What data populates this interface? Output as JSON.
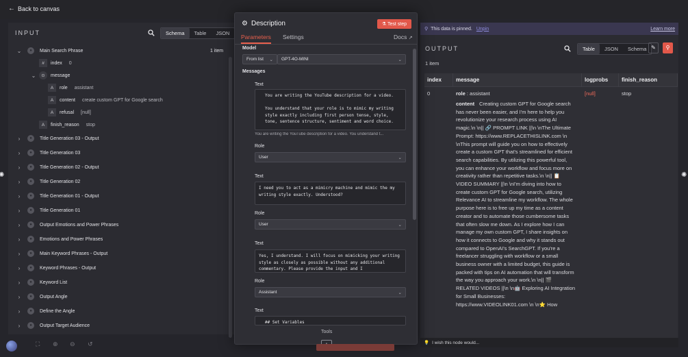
{
  "nav": {
    "back_label": "Back to canvas"
  },
  "input": {
    "header": "INPUT",
    "view_tabs": [
      "Schema",
      "Table",
      "JSON"
    ],
    "active_view": "Schema",
    "root": {
      "name": "Main Search Phrase",
      "count": "1 item"
    },
    "fields": [
      {
        "type": "#",
        "key": "index",
        "value": "0"
      },
      {
        "type": "obj",
        "key": "message",
        "value": ""
      },
      {
        "type": "A",
        "key": "role",
        "value": "assistant"
      },
      {
        "type": "A",
        "key": "content",
        "value": "create custom GPT for Google search"
      },
      {
        "type": "A",
        "key": "refusal",
        "value": "[null]"
      },
      {
        "type": "A",
        "key": "finish_reason",
        "value": "stop"
      }
    ],
    "nodes": [
      "Title Generation 03 - Output",
      "Title Generation 03",
      "Title Generation 02 - Output",
      "Title Generation 02",
      "Title Generation 01 - Output",
      "Title Generation 01",
      "Output Emotions and Power Phrases",
      "Emotions and Power Phrases",
      "Main Keyword Phrases - Output",
      "Keyword Phrases - Output",
      "Keyword List",
      "Output Angle",
      "Define the Angle",
      "Output Target Audience"
    ]
  },
  "modal": {
    "title": "Description",
    "test_button": "Test step",
    "tabs": [
      "Parameters",
      "Settings"
    ],
    "active_tab": "Parameters",
    "docs_label": "Docs",
    "model_label": "Model",
    "model_source": "From list",
    "model_value": "GPT-4O-MINI",
    "messages_label": "Messages",
    "text_label": "Text",
    "role_label": "Role",
    "messages": [
      {
        "text": "You are writing the YouTube description for a video.\n\nYou understand that your role is to mimic my writing style exactly including first person tense, style, tone, sentence structure, sentiment and word choice.",
        "preview": "You are writing the YouTube description for a video. You understand t...",
        "role": "User"
      },
      {
        "text": "I need you to act as a mimicry machine and mimic the my writing style exactly. Understood?",
        "preview": "",
        "role": "User"
      },
      {
        "text": "Yes, I understand. I will focus on mimicking your writing style as closely as possible without any additional commentary. Please provide the input and I",
        "preview": "",
        "role": "Assistant"
      },
      {
        "text": "## Set Variables",
        "preview": "",
        "role": ""
      }
    ],
    "tools_label": "Tools",
    "add_label": "+"
  },
  "output": {
    "pinned_text": "This data is pinned.",
    "unpin_label": "Unpin",
    "learn_more_label": "Learn more",
    "header": "OUTPUT",
    "view_tabs": [
      "Table",
      "JSON",
      "Schema"
    ],
    "active_view": "Table",
    "item_count": "1 item",
    "columns": [
      "index",
      "message",
      "logprobs",
      "finish_reason"
    ],
    "row": {
      "index": "0",
      "role_key": "role",
      "role_value": "assistant",
      "content_key": "content",
      "content_value": "Creating custom GPT for Google search has never been easier, and I'm here to help you revolutionize your research process using AI magic.\\n \\n|| 🔗 PROMPT LINK ||\\n \\nThe Ultimate Prompt: https://www.REPLACETHISLINK.com \\n \\nThis prompt will guide you on how to effectively create a custom GPT that's streamlined for efficient search capabilities. By utilizing this powerful tool, you can enhance your workflow and focus more on creativity rather than repetitive tasks.\\n \\n|| 📋 VIDEO SUMMARY ||\\n \\nI'm diving into how to create custom GPT for Google search, utilizing Relevance AI to streamline my workflow. The whole purpose here is to free up my time as a content creator and to automate those cumbersome tasks that often slow me down. As I explore how I can manage my own custom GPT, I share insights on how it connects to Google and why it stands out compared to OpenAI's SearchGPT. If you're a freelancer struggling with workflow or a small business owner with a limited budget, this guide is packed with tips on AI automation that will transform the way you approach your work.\\n \\n|| 🎬 RELATED VIDEOS ||\\n \\n🤖 Exploring AI Integration for Small Businesses: https://www.VIDEOLINK01.com \\n \\n⭐ How",
      "logprobs": "[null]",
      "finish_reason": "stop"
    },
    "wish_text": "I wish this node would..."
  },
  "colors": {
    "accent": "#e9604d",
    "pinned_bg": "#3a3750",
    "link": "#8f8de0"
  }
}
